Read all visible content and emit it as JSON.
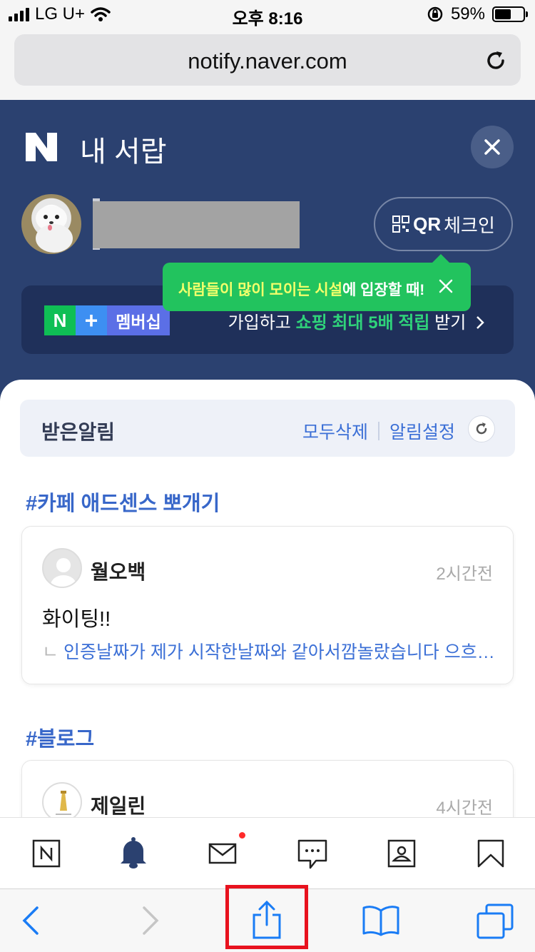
{
  "status_bar": {
    "carrier": "LG U+",
    "time": "오후 8:16",
    "battery": "59%",
    "battery_level": 0.59
  },
  "browser": {
    "url": "notify.naver.com"
  },
  "drawer": {
    "title": "내 서랍",
    "qr_checkin": {
      "strong": "QR",
      "label": "체크인"
    },
    "membership": {
      "logo_n": "N",
      "logo_plus": "+",
      "logo_label": "멤버십",
      "text_prefix": "가입하고",
      "text_highlight": "쇼핑 최대 5배 적립",
      "text_suffix": "받기"
    },
    "tooltip": {
      "highlight": "사람들이 많이 모이는 시설",
      "rest": "에 입장할 때!"
    }
  },
  "notifications": {
    "title": "받은알림",
    "delete_all": "모두삭제",
    "settings": "알림설정",
    "groups": [
      {
        "title": "#카페 애드센스 뽀개기",
        "items": [
          {
            "name": "월오백",
            "time": "2시간전",
            "body": "화이팅!!",
            "reply_mark": "ㄴ",
            "reply": "인증날짜가 제가 시작한날짜와 같아서깜놀랐습니다 으흐…"
          }
        ]
      },
      {
        "title": "#블로그",
        "items": [
          {
            "name": "제일린",
            "time": "4시간전"
          }
        ]
      }
    ]
  },
  "tabbar": {
    "items": [
      "naver-home-icon",
      "bell-icon",
      "mail-icon",
      "chat-icon",
      "contacts-icon",
      "bookmark-icon"
    ],
    "active": "bell-icon",
    "badge": "mail-icon"
  },
  "safari_toolbar": {
    "items": [
      "back-icon",
      "forward-icon",
      "share-icon",
      "bookmarks-icon",
      "tabs-icon"
    ],
    "highlighted": "share-icon",
    "accent": "#1a7cf5",
    "highlight_color": "#e8121e"
  }
}
